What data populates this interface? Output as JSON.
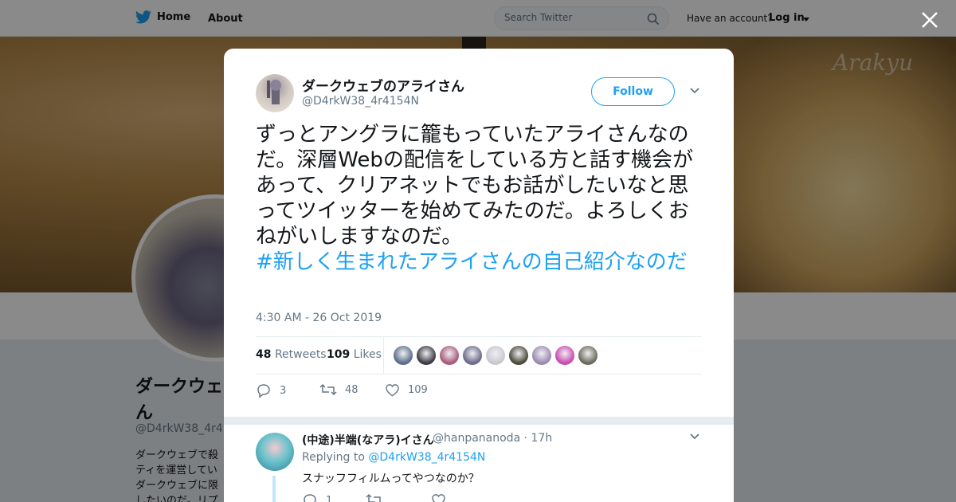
{
  "header": {
    "home_label": "Home",
    "about_label": "About",
    "search_placeholder": "Search Twitter",
    "account_prompt": "Have an account?",
    "login_label": "Log in"
  },
  "profile": {
    "name_line1": "ダークウェ",
    "name_line2": "ん",
    "handle": "@D4rkW38_4r41",
    "bio_lines": [
      "ダークウェブで殺",
      "ティを運営してい",
      "ダークウェブに限",
      "したいのだ。リプ"
    ],
    "banner_logo": "Arakyu"
  },
  "tweet": {
    "author_name": "ダークウェブのアライさん",
    "author_handle": "@D4rkW38_4r4154N",
    "follow_label": "Follow",
    "text": "ずっとアングラに籠もっていたアライさんなのだ。深層Webの配信をしている方と話す機会があって、クリアネットでもお話がしたいなと思ってツイッターを始めてみたのだ。よろしくおねがいしますなのだ。",
    "hashtag": "#新しく生まれたアライさんの自己紹介なのだ",
    "timestamp": "4:30 AM - 26 Oct 2019",
    "retweets_count": "48",
    "retweets_label": "Retweets",
    "likes_count": "109",
    "likes_label": "Likes",
    "actions": {
      "replies": "3",
      "retweets": "48",
      "likes": "109"
    },
    "likers": [
      {
        "color": "#5a6e8c"
      },
      {
        "color": "#3a3a44"
      },
      {
        "color": "#a85a7a"
      },
      {
        "color": "#6a6a8a"
      },
      {
        "color": "#c8c8d0"
      },
      {
        "color": "#4a4a3a"
      },
      {
        "color": "#9a8ab0"
      },
      {
        "color": "#c84ab0"
      },
      {
        "color": "#6a6a5a"
      }
    ]
  },
  "reply": {
    "name": "(中途)半端(なアラ)イさん",
    "handle": "@hanpananoda",
    "time": "· 17h",
    "replying_prefix": "Replying to",
    "replying_to": "@D4rkW38_4r4154N",
    "text": "スナッフフィルムってやつなのか？",
    "replies": "1"
  },
  "colors": {
    "accent": "#1da1f2",
    "overlay": "rgba(0,0,0,0.46)"
  }
}
